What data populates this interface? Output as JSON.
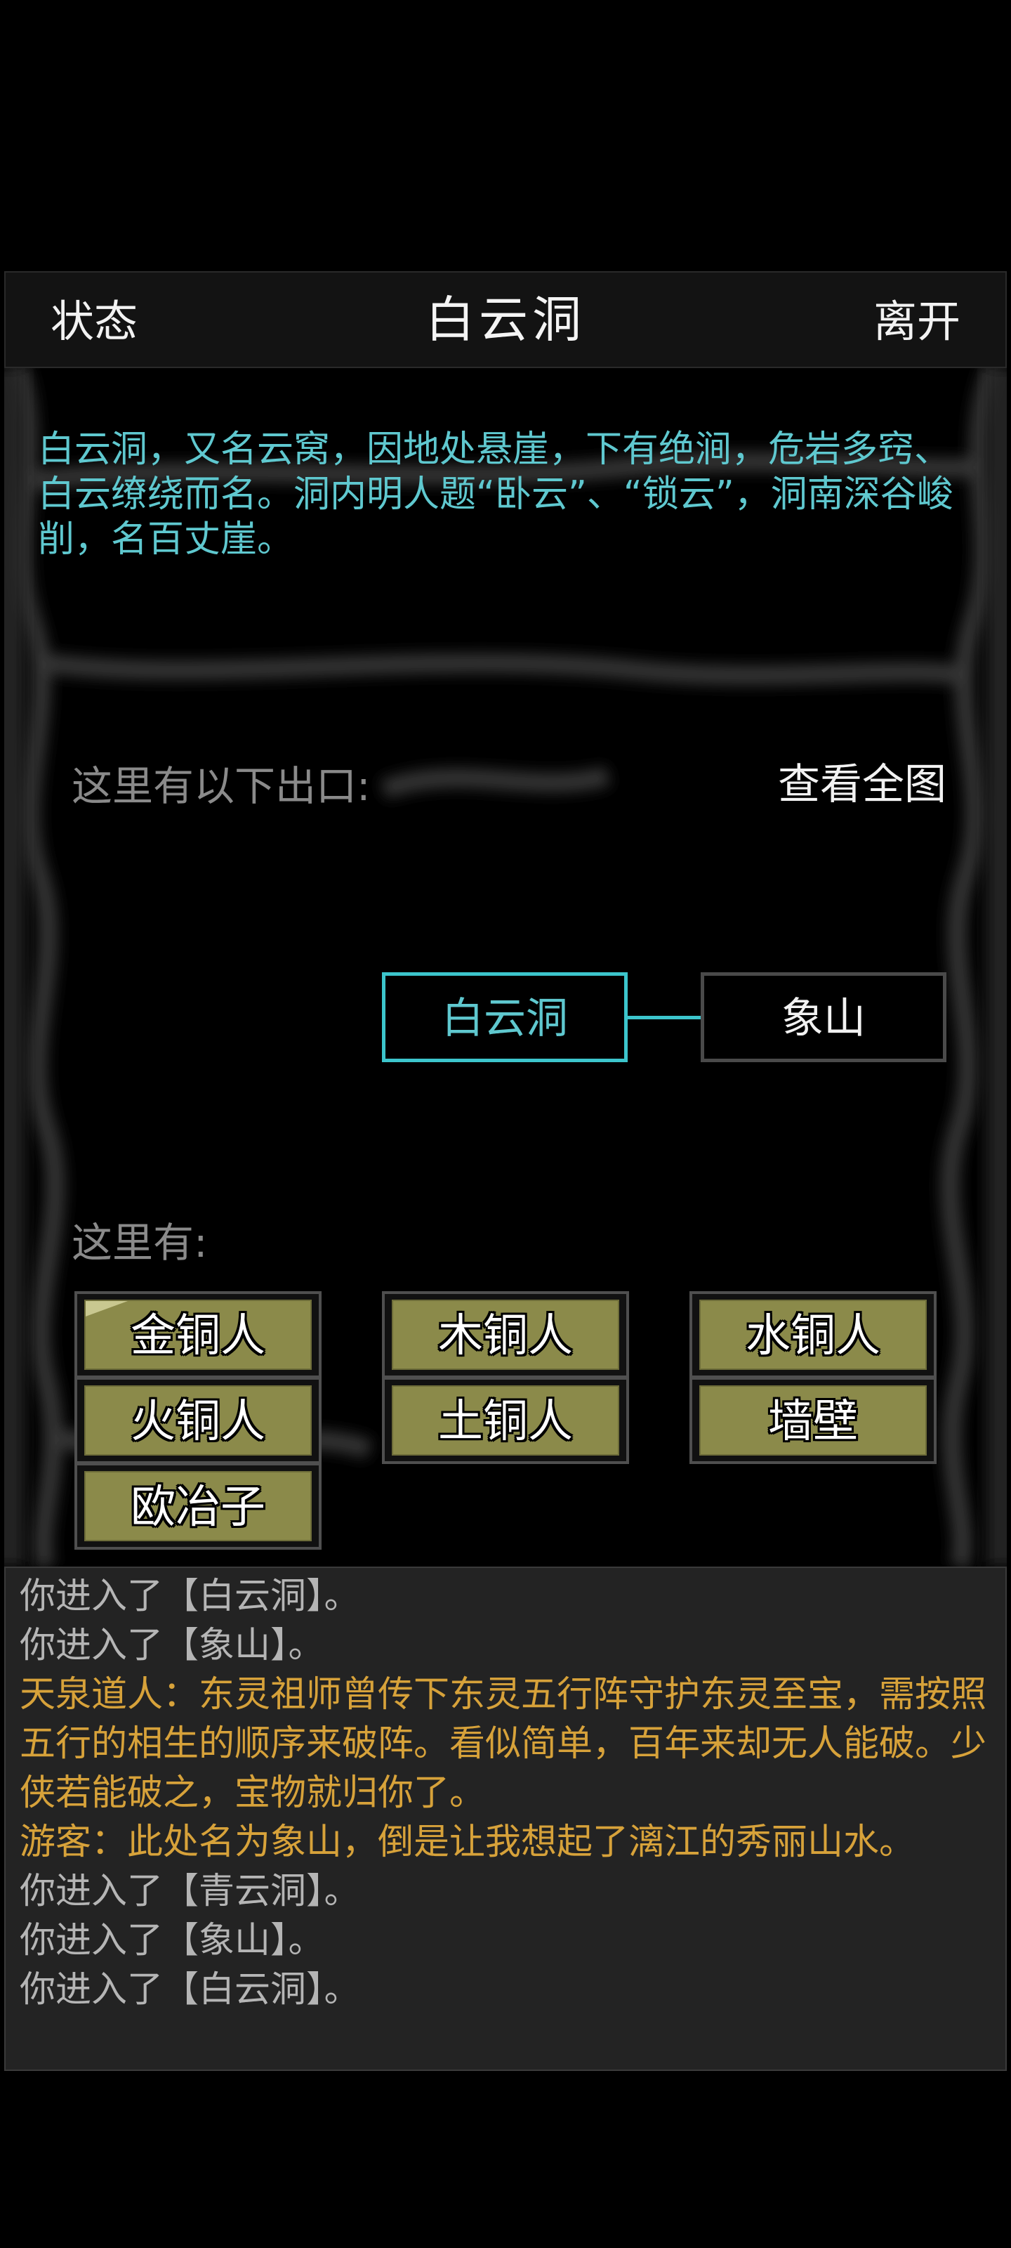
{
  "header": {
    "status_label": "状态",
    "title": "白云洞",
    "leave_label": "离开"
  },
  "room": {
    "description": "白云洞，又名云窝，因地处悬崖，下有绝涧，危岩多窍、白云缭绕而名。洞内明人题“卧云”、“锁云”，洞南深谷峻削，名百丈崖。",
    "exits_label": "这里有以下出口:",
    "full_map_label": "查看全图",
    "exits": {
      "current": "白云洞",
      "east": "象山"
    },
    "here_label": "这里有:",
    "npcs": [
      "金铜人",
      "木铜人",
      "水铜人",
      "火铜人",
      "土铜人",
      "墙壁",
      "欧冶子"
    ]
  },
  "log": [
    {
      "type": "sys",
      "text": "你进入了【白云洞】。"
    },
    {
      "type": "sys",
      "text": "你进入了【象山】。"
    },
    {
      "type": "say",
      "text": "天泉道人：东灵祖师曾传下东灵五行阵守护东灵至宝，需按照五行的相生的顺序来破阵。看似简单，百年来却无人能破。少侠若能破之，宝物就归你了。"
    },
    {
      "type": "say",
      "text": "游客：此处名为象山，倒是让我想起了漓江的秀丽山水。"
    },
    {
      "type": "sys",
      "text": "你进入了【青云洞】。"
    },
    {
      "type": "sys",
      "text": "你进入了【象山】。"
    },
    {
      "type": "sys",
      "text": "你进入了【白云洞】。"
    }
  ],
  "colors": {
    "accent": "#3cc5cc",
    "description": "#5fc8cf",
    "npc_button": "#8b8a4a",
    "dialogue": "#d7a23a"
  }
}
